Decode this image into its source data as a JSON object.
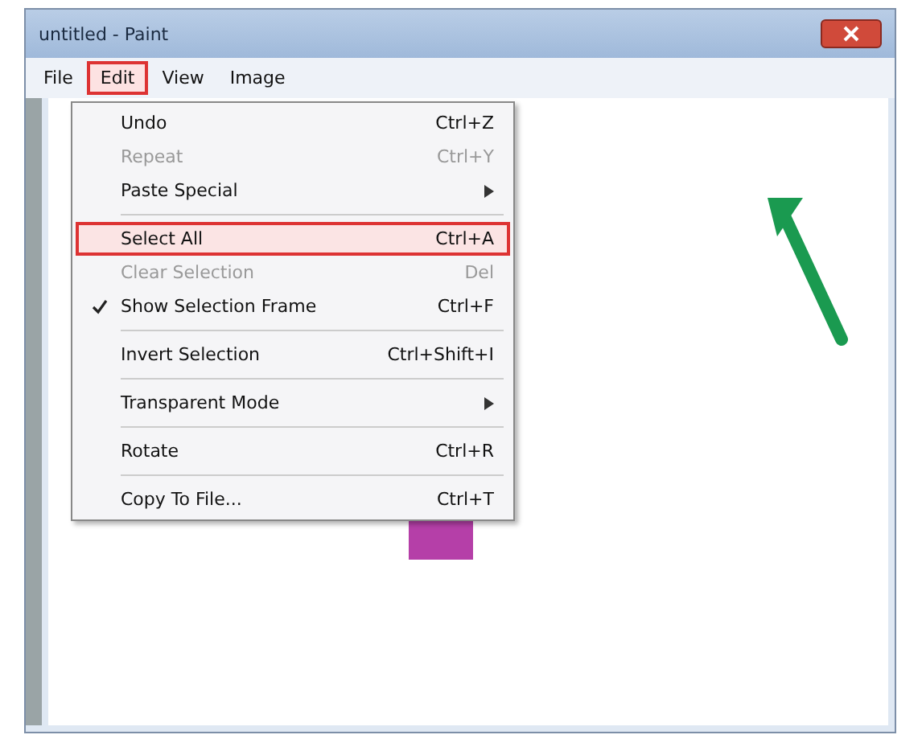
{
  "window": {
    "title": "untitled - Paint"
  },
  "menu_bar": [
    {
      "label": "File",
      "selected": false
    },
    {
      "label": "Edit",
      "selected": true
    },
    {
      "label": "View",
      "selected": false
    },
    {
      "label": "Image",
      "selected": false
    }
  ],
  "menu": [
    {
      "kind": "item",
      "label": "Undo",
      "shortcut": "Ctrl+Z",
      "submenu": false,
      "disabled": false,
      "checked": false,
      "selected": false
    },
    {
      "kind": "item",
      "label": "Repeat",
      "shortcut": "Ctrl+Y",
      "submenu": false,
      "disabled": true,
      "checked": false,
      "selected": false
    },
    {
      "kind": "item",
      "label": "Paste Special",
      "submenu": true,
      "disabled": false,
      "checked": false,
      "selected": false
    },
    {
      "kind": "separator"
    },
    {
      "kind": "item",
      "label": "Select All",
      "shortcut": "Ctrl+A",
      "submenu": false,
      "disabled": false,
      "checked": false,
      "selected": true
    },
    {
      "kind": "item",
      "label": "Clear Selection",
      "shortcut": "Del",
      "submenu": false,
      "disabled": true,
      "checked": false,
      "selected": false
    },
    {
      "kind": "item",
      "label": "Show Selection Frame",
      "shortcut": "Ctrl+F",
      "submenu": false,
      "disabled": false,
      "checked": true,
      "selected": false
    },
    {
      "kind": "separator"
    },
    {
      "kind": "item",
      "label": "Invert Selection",
      "shortcut": "Ctrl+Shift+I",
      "submenu": false,
      "disabled": false,
      "checked": false,
      "selected": false
    },
    {
      "kind": "separator"
    },
    {
      "kind": "item",
      "label": "Transparent Mode",
      "submenu": true,
      "disabled": false,
      "checked": false,
      "selected": false
    },
    {
      "kind": "separator"
    },
    {
      "kind": "item",
      "label": "Rotate",
      "shortcut": "Ctrl+R",
      "submenu": false,
      "disabled": false,
      "checked": false,
      "selected": false
    },
    {
      "kind": "separator"
    },
    {
      "kind": "item",
      "label": "Copy To File...",
      "shortcut": "Ctrl+T",
      "submenu": false,
      "disabled": false,
      "checked": false,
      "selected": false
    }
  ]
}
